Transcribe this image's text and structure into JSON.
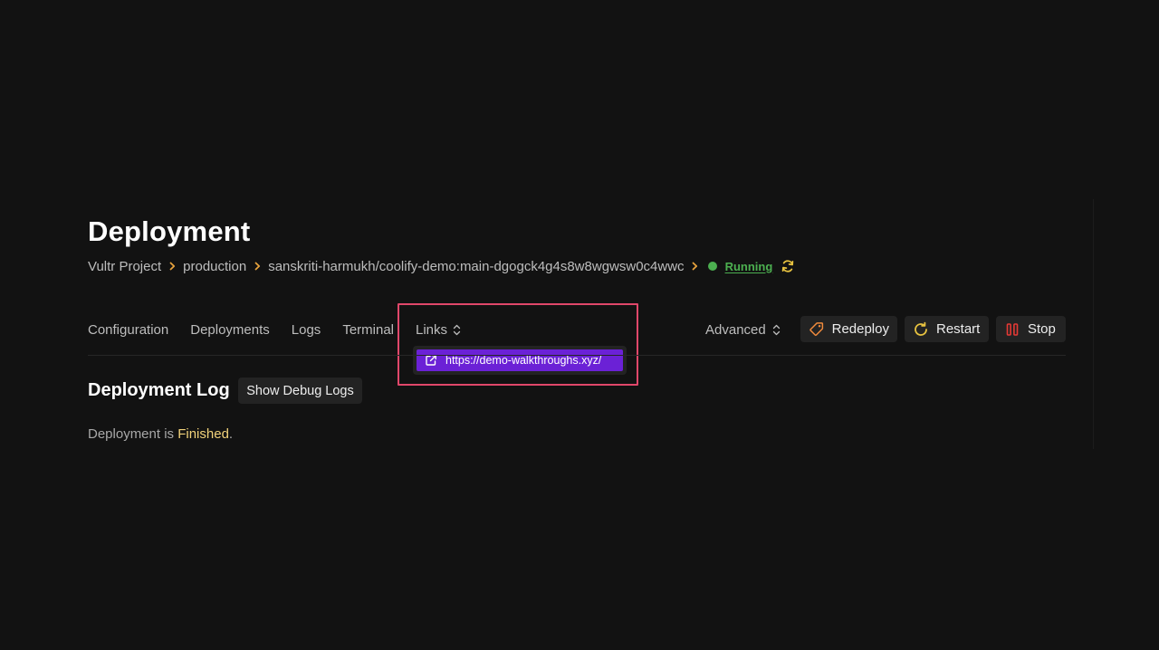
{
  "page": {
    "title": "Deployment"
  },
  "breadcrumb": {
    "project": "Vultr Project",
    "environment": "production",
    "resource": "sanskriti-harmukh/coolify-demo:main-dgogck4g4s8w8wgwsw0c4wwc",
    "status": "Running",
    "status_color": "#4caf50",
    "separator_icon": "chevron-right-icon",
    "refresh_icon": "refresh-icon"
  },
  "tabs": {
    "items": [
      {
        "label": "Configuration"
      },
      {
        "label": "Deployments"
      },
      {
        "label": "Logs"
      },
      {
        "label": "Terminal"
      },
      {
        "label": "Links"
      }
    ]
  },
  "links_dropdown": {
    "items": [
      {
        "label": "https://demo-walkthroughs.xyz/",
        "icon": "external-link-icon"
      }
    ],
    "highlight_color": "#e0476a",
    "item_color": "#6b21d6"
  },
  "actions": {
    "advanced_label": "Advanced",
    "redeploy_label": "Redeploy",
    "restart_label": "Restart",
    "stop_label": "Stop",
    "redeploy_icon": "tag-icon",
    "restart_icon": "restart-icon",
    "stop_icon": "pause-icon"
  },
  "deployment_log": {
    "title": "Deployment Log",
    "debug_button_label": "Show Debug Logs",
    "status_prefix": "Deployment is ",
    "status_value": "Finished",
    "status_suffix": ".",
    "status_value_color": "#f1d27a"
  }
}
